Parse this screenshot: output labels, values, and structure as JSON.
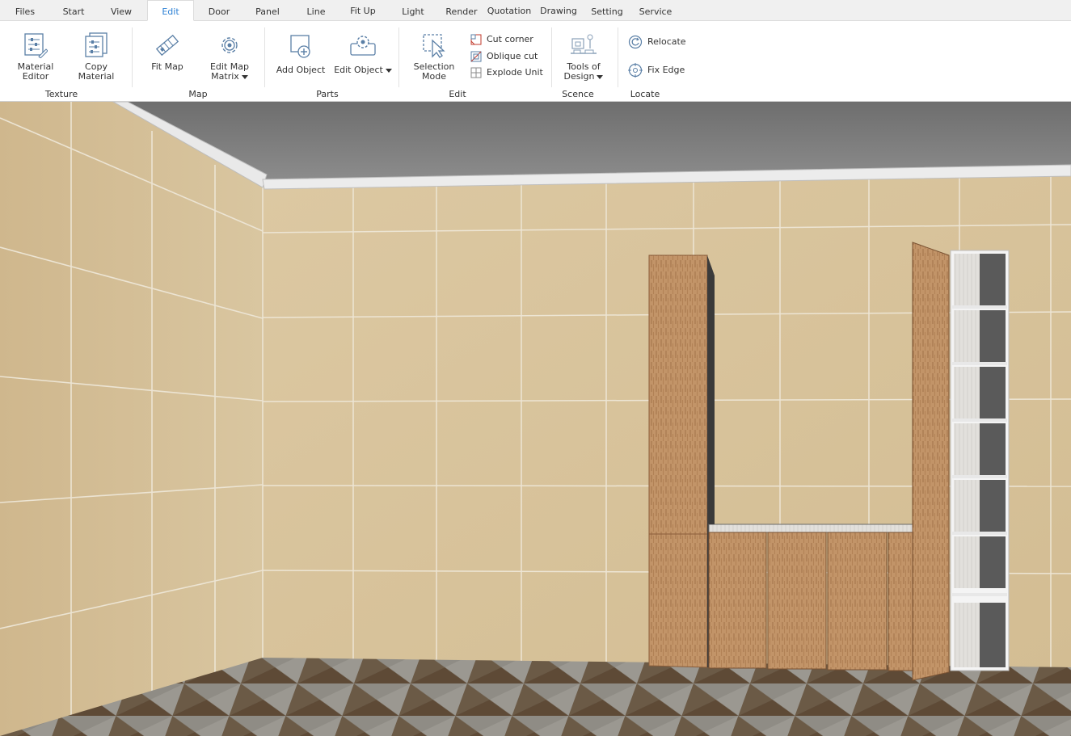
{
  "tabs": [
    {
      "label": "Files",
      "active": false
    },
    {
      "label": "Start",
      "active": false
    },
    {
      "label": "View",
      "active": false
    },
    {
      "label": "Edit",
      "active": true
    },
    {
      "label": "Door",
      "active": false
    },
    {
      "label": "Panel",
      "active": false
    },
    {
      "label": "Line",
      "active": false
    },
    {
      "label": "Fit Up",
      "active": false
    },
    {
      "label": "Light",
      "active": false
    },
    {
      "label": "Render",
      "active": false
    },
    {
      "label": "Quotation",
      "active": false
    },
    {
      "label": "Drawing",
      "active": false
    },
    {
      "label": "Setting",
      "active": false
    },
    {
      "label": "Service",
      "active": false
    }
  ],
  "ribbon": {
    "texture": {
      "group_label": "Texture",
      "material_editor": [
        "Material",
        "Editor"
      ],
      "copy_material": [
        "Copy",
        "Material"
      ]
    },
    "map": {
      "group_label": "Map",
      "fit_map": "Fit Map",
      "edit_map_matrix": [
        "Edit Map",
        "Matrix"
      ]
    },
    "parts": {
      "group_label": "Parts",
      "add_object": "Add Object",
      "edit_object": "Edit Object"
    },
    "edit": {
      "group_label": "Edit",
      "selection_mode": [
        "Selection",
        "Mode"
      ],
      "cut_corner": "Cut corner",
      "oblique_cut": "Oblique cut",
      "explode_unit": "Explode Unit"
    },
    "scence": {
      "group_label": "Scence",
      "tools_of_design": [
        "Tools of",
        "Design"
      ]
    },
    "locate": {
      "group_label": "Locate",
      "relocate": "Relocate",
      "fix_edge": "Fix Edge"
    }
  },
  "colors": {
    "accent": "#2a7fd4",
    "icon": "#5a7fa6",
    "tile": "#d8c29a",
    "wood": "#b8865a",
    "ceiling": "#7a7a7a"
  }
}
